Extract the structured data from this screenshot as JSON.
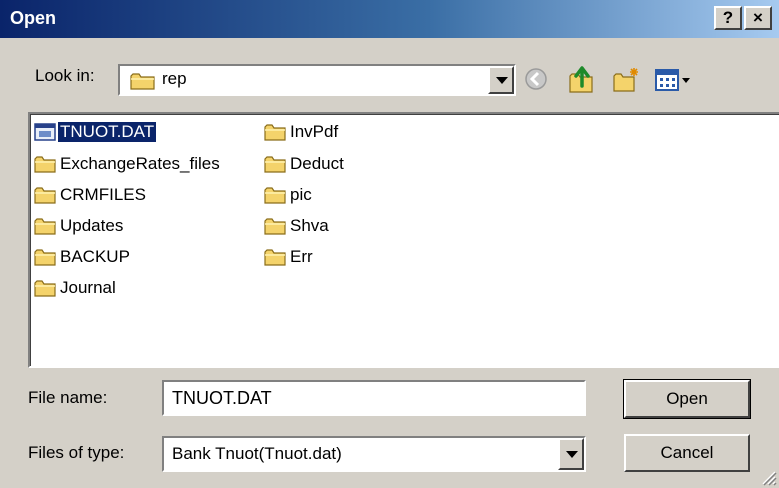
{
  "dialog": {
    "title": "Open",
    "help_button": "?",
    "close_button": "×"
  },
  "lookin": {
    "label": "Look in:",
    "value": "rep",
    "icon": "folder-icon"
  },
  "toolbar": {
    "back": "back-icon",
    "up": "up-folder-icon",
    "new_folder": "new-folder-icon",
    "view_menu": "view-menu-icon"
  },
  "files": [
    {
      "name": "TNUOT.DAT",
      "type": "file",
      "selected": true
    },
    {
      "name": "ExchangeRates_files",
      "type": "folder"
    },
    {
      "name": "CRMFILES",
      "type": "folder"
    },
    {
      "name": "Updates",
      "type": "folder"
    },
    {
      "name": "BACKUP",
      "type": "folder"
    },
    {
      "name": "Journal",
      "type": "folder"
    },
    {
      "name": "InvPdf",
      "type": "folder"
    },
    {
      "name": "Deduct",
      "type": "folder"
    },
    {
      "name": "pic",
      "type": "folder"
    },
    {
      "name": "Shva",
      "type": "folder"
    },
    {
      "name": "Err",
      "type": "folder"
    }
  ],
  "form": {
    "filename_label": "File name:",
    "filename_value": "TNUOT.DAT",
    "filetype_label": "Files of type:",
    "filetype_value": "Bank Tnuot(Tnuot.dat)",
    "open_button": "Open",
    "cancel_button": "Cancel"
  },
  "colors": {
    "title_gradient_start": "#0a246a",
    "title_gradient_end": "#a6caf0",
    "window_bg": "#d4d0c8",
    "selection": "#0a246a",
    "folder_yellow": "#f4d36b"
  }
}
